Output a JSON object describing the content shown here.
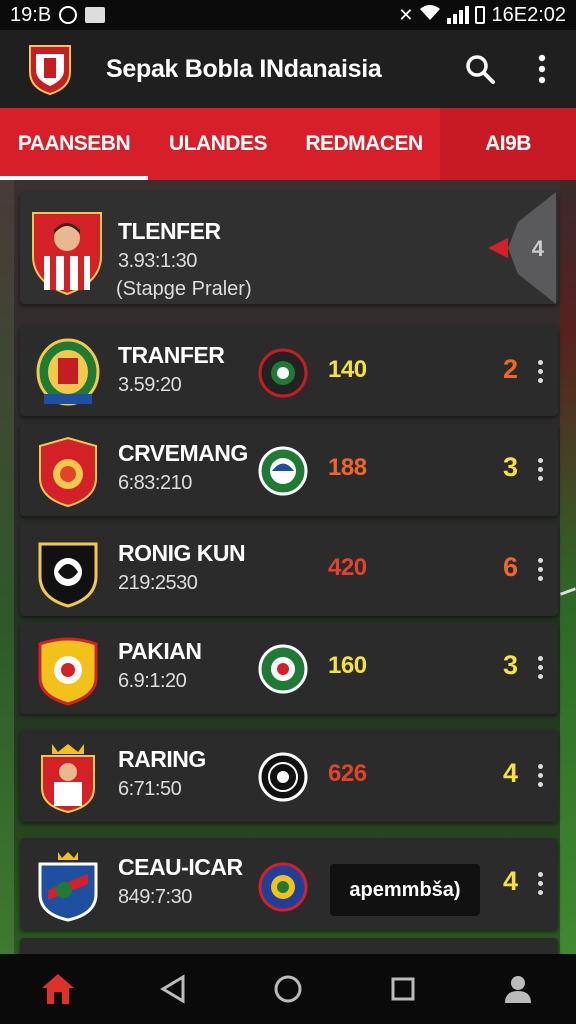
{
  "status_bar": {
    "time": "19:",
    "time_suffix": "B",
    "clock": "16E2:02"
  },
  "app": {
    "title": "Sepak Bobla INdanaisia"
  },
  "tabs": [
    {
      "label": "PAANSEBN",
      "active": true
    },
    {
      "label": "ULANDES",
      "active": false
    },
    {
      "label": "REDMACEN",
      "active": false
    },
    {
      "label": "AI9B",
      "active": false
    }
  ],
  "featured": {
    "title": "TLENFER",
    "time": "3.93:1:30",
    "note": "(Stapge Praler)",
    "count": "4"
  },
  "rows": [
    {
      "name": "TRANFER",
      "time": "3.59:20",
      "score": "140",
      "score_color": "#f3e33a",
      "rank": "2",
      "rank_color": "#f06a1a",
      "crest": "green-yellow-crest",
      "badge": "dark-red-badge"
    },
    {
      "name": "CRVEMANG",
      "time": "6:83:210",
      "score": "188",
      "score_color": "#f0662a",
      "rank": "3",
      "rank_color": "#f3e33a",
      "crest": "red-orange-crest",
      "badge": "green-white-badge"
    },
    {
      "name": "RONIG KUN",
      "time": "219:2530",
      "score": "420",
      "score_color": "#e2442a",
      "rank": "6",
      "rank_color": "#f0662a",
      "crest": "black-white-crest",
      "badge": "none"
    },
    {
      "name": "PAKIAN",
      "time": "6.9:1:20",
      "score": "160",
      "score_color": "#f3e33a",
      "rank": "3",
      "rank_color": "#f3e33a",
      "crest": "yellow-red-crest",
      "badge": "green-red-badge"
    },
    {
      "name": "RARING",
      "time": "6:71:50",
      "score": "626",
      "score_color": "#e2442a",
      "rank": "4",
      "rank_color": "#f3e33a",
      "crest": "crowned-red-crest",
      "badge": "black-white-badge"
    },
    {
      "name": "CEAU-ICAR",
      "time": "849:7:30",
      "score": "",
      "score_color": "#ffffff",
      "rank": "4",
      "rank_color": "#f3e33a",
      "crest": "blue-crowned-crest",
      "badge": "blue-red-badge",
      "tooltip": "apemmbša)"
    }
  ],
  "colors": {
    "accent": "#d71f2a",
    "card": "#2b2b2c",
    "appbar": "#1f1f1f"
  }
}
